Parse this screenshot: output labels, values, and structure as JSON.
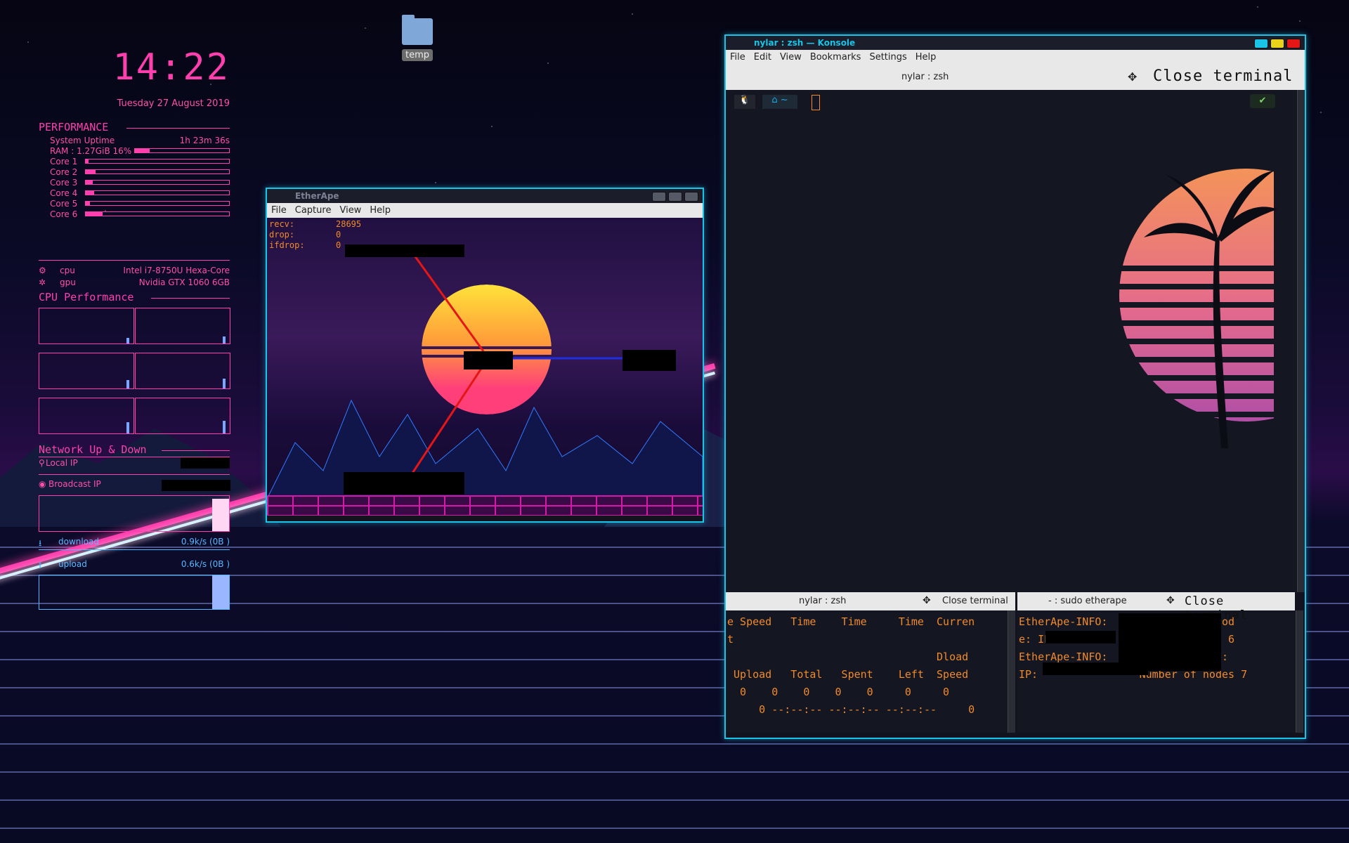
{
  "conky": {
    "clock": "14:22",
    "date": "Tuesday 27 August 2019",
    "performance_title": "PERFORMANCE",
    "uptime_label": "System Uptime",
    "uptime_value": "1h 23m 36s",
    "ram_label": "RAM : 1.27GiB 16%",
    "ram_fraction": 0.16,
    "cores": [
      {
        "label": "Core 1",
        "fraction": 0.02
      },
      {
        "label": "Core 2",
        "fraction": 0.07
      },
      {
        "label": "Core 3",
        "fraction": 0.05
      },
      {
        "label": "Core 4",
        "fraction": 0.06
      },
      {
        "label": "Core 5",
        "fraction": 0.03
      },
      {
        "label": "Core 6",
        "fraction": 0.12
      }
    ],
    "cpu_label": "cpu",
    "cpu_value": "Intel i7-8750U Hexa-Core",
    "gpu_label": "gpu",
    "gpu_value": "Nvidia GTX 1060 6GB",
    "cpu_perf_title": "CPU Performance",
    "network_title": "Network Up & Down",
    "local_ip_label": "Local IP",
    "broadcast_ip_label": "Broadcast IP",
    "download_label": "download",
    "download_value": "0.9k/s (0B  )",
    "upload_label": "upload",
    "upload_value": "0.6k/s (0B  )"
  },
  "desktop": {
    "folder_label": "temp"
  },
  "etherape": {
    "title": "EtherApe",
    "menu": [
      "File",
      "Capture",
      "View",
      "Help"
    ],
    "stats": [
      {
        "label": "recv:",
        "value": "28695"
      },
      {
        "label": "drop:",
        "value": "0"
      },
      {
        "label": "ifdrop:",
        "value": "0"
      }
    ]
  },
  "konsole": {
    "title": "nylar : zsh — Konsole",
    "menu": [
      "File",
      "Edit",
      "View",
      "Bookmarks",
      "Settings",
      "Help"
    ],
    "tab_title": "nylar : zsh",
    "close_terminal": "Close terminal",
    "prompt_home": "~",
    "status_ok": "✔",
    "pane_left": {
      "title": "nylar : zsh",
      "close": "Close terminal",
      "lines": [
        "e Speed   Time    Time     Time  Curren",
        "t",
        "                                 Dload",
        " Upload   Total   Spent    Left  Speed",
        "  0    0    0    0    0     0     0",
        "     0 --:--:-- --:--:-- --:--:--     0"
      ]
    },
    "pane_right": {
      "title": "- : sudo etherape",
      "close": "Close terminal",
      "lines": [
        "EtherApe-INFO:          delete nod",
        "e: IP: 2                of nodes 6",
        "EtherApe-INFO:          New node:",
        "IP:                Number of nodes 7"
      ]
    }
  },
  "colors": {
    "accent": "#ff3fae",
    "frame": "#19c4e6",
    "terminal_text": "#f08a2a"
  }
}
